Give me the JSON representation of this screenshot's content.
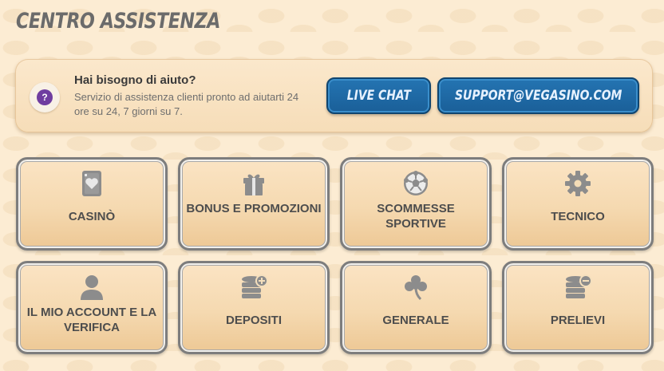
{
  "page": {
    "title": "CENTRO ASSISTENZA"
  },
  "help": {
    "heading": "Hai bisogno di aiuto?",
    "description": "Servizio di assistenza clienti pronto ad aiutarti 24 ore su 24, 7 giorni su 7.",
    "icon": "question-icon",
    "live_chat_label": "LIVE CHAT",
    "email_label": "SUPPORT@VEGASINO.COM"
  },
  "categories": [
    {
      "label": "CASINÒ",
      "icon": "playing-card-icon"
    },
    {
      "label": "BONUS E PROMOZIONI",
      "icon": "gift-icon"
    },
    {
      "label": "SCOMMESSE SPORTIVE",
      "icon": "soccer-ball-icon"
    },
    {
      "label": "TECNICO",
      "icon": "gear-icon"
    },
    {
      "label": "IL MIO ACCOUNT E LA VERIFICA",
      "icon": "user-icon"
    },
    {
      "label": "DEPOSITI",
      "icon": "coins-plus-icon"
    },
    {
      "label": "GENERALE",
      "icon": "clover-icon"
    },
    {
      "label": "PRELIEVI",
      "icon": "coins-minus-icon"
    }
  ],
  "colors": {
    "accent_blue": "#1f6aa8",
    "title_gray": "#6b6b6b",
    "help_purple": "#6f3da0"
  }
}
